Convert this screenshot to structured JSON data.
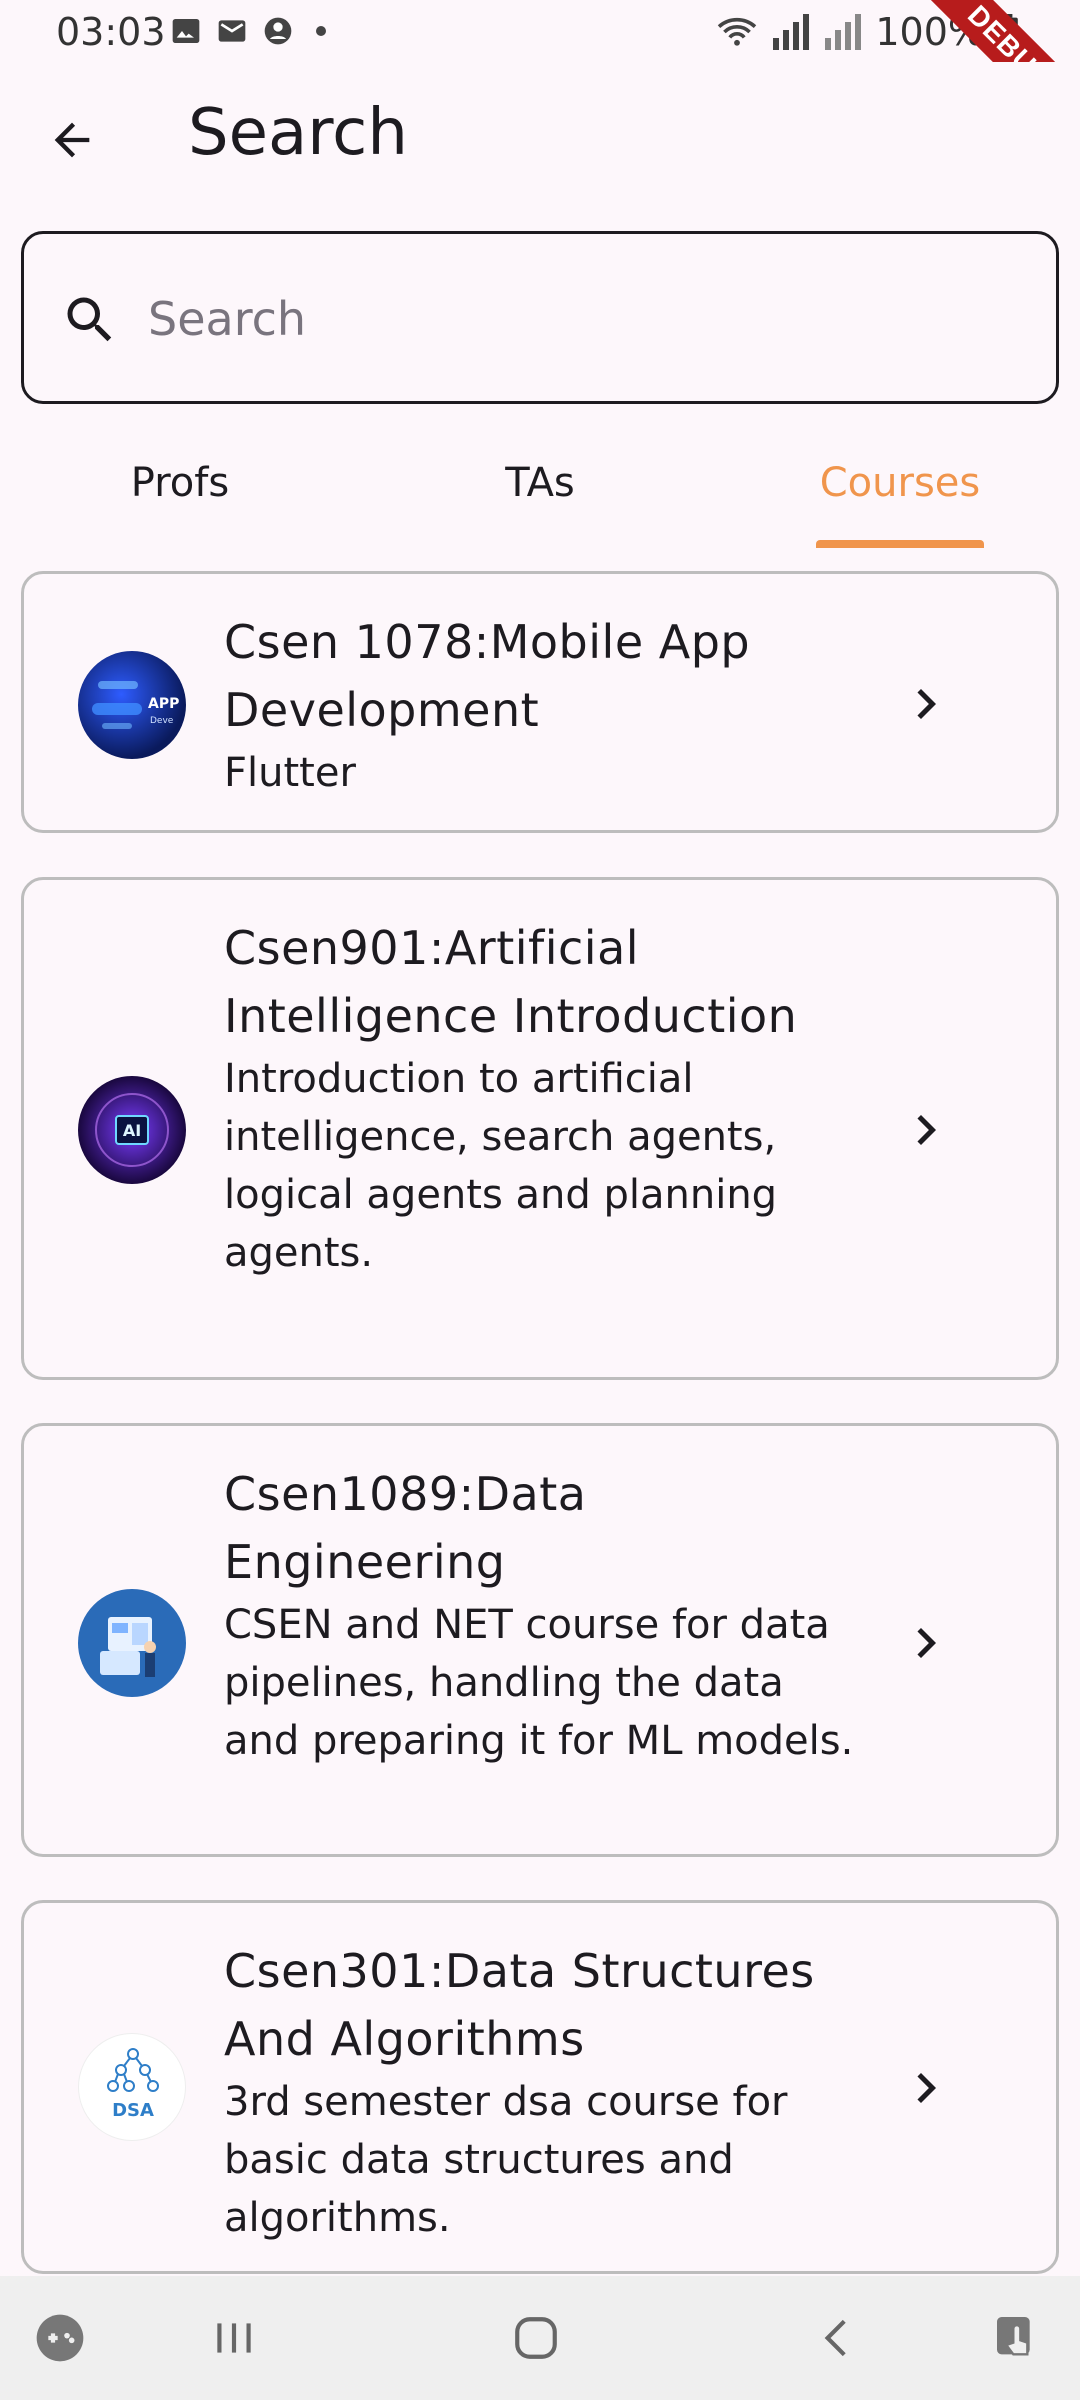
{
  "status_bar": {
    "time": "03:03",
    "battery": "100%",
    "debug_label": "DEBUG"
  },
  "app_bar": {
    "title": "Search"
  },
  "search": {
    "placeholder": "Search",
    "value": ""
  },
  "tabs": [
    {
      "label": "Profs",
      "active": false
    },
    {
      "label": "TAs",
      "active": false
    },
    {
      "label": "Courses",
      "active": true
    }
  ],
  "courses": [
    {
      "title": "Csen 1078:Mobile App Development",
      "description": "Flutter",
      "avatar_label": "APP"
    },
    {
      "title": "Csen901:Artificial Intelligence Introduction",
      "description": "Introduction to artificial intelligence, search agents, logical agents and planning agents.",
      "avatar_label": "AI"
    },
    {
      "title": "Csen1089:Data Engineering",
      "description": "CSEN and NET course for data pipelines, handling the data and preparing it for ML models.",
      "avatar_label": ""
    },
    {
      "title": "Csen301:Data Structures And Algorithms",
      "description": "3rd semester dsa course for basic data structures and algorithms.",
      "avatar_label": "DSA"
    }
  ],
  "colors": {
    "accent": "#f0954c",
    "background": "#fdf7fb",
    "card_border": "#bdbdbd"
  }
}
